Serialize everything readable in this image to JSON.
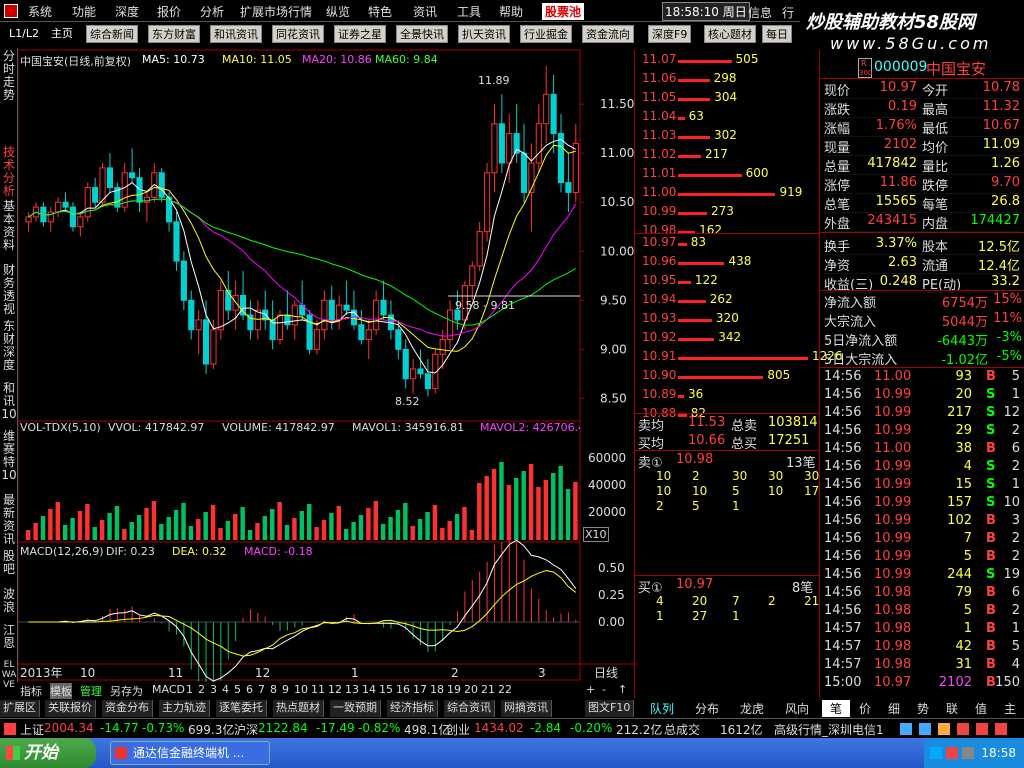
{
  "menu": {
    "items": [
      "系统",
      "功能",
      "深度",
      "报价",
      "分析",
      "扩展市场行情",
      "纵览",
      "特色",
      "资讯",
      "工具",
      "帮助"
    ],
    "hot": "股票池",
    "clock": "18:58:10 周日",
    "info": "信息",
    "trade": "行"
  },
  "watermark": {
    "brand": "炒股辅助教材58股网",
    "url": "www.58Gu.com"
  },
  "tabs": [
    "L1/L2",
    "主页",
    "综合新闻",
    "东方财富",
    "和讯资讯",
    "同花资讯",
    "证券之星",
    "全景快讯",
    "扒天资讯",
    "行业掘金",
    "资金流向",
    "深度F9",
    "核心题材",
    "每日"
  ],
  "sidebar": [
    "分时走势",
    "技术分析",
    "基本资料",
    "财务透视",
    "东财深度",
    "和讯10",
    "维赛特10",
    "最新资讯",
    "股吧",
    "波浪",
    "江恩",
    "EL WA VE"
  ],
  "chart_header": {
    "name": "中国宝安(日线,前复权)",
    "ma5": "MA5: 10.73",
    "ma10": "MA10: 11.05",
    "ma20": "MA20: 10.86",
    "ma60": "MA60: 9.84",
    "high_label": "11.89",
    "low_label": "8.52",
    "range_label": "9.58 - 9.81"
  },
  "vol_header": {
    "name": "VOL-TDX(5,10)",
    "vvol": "VVOL: 417842.97",
    "volume": "VOLUME: 417842.97",
    "mavol1": "MAVOL1: 345916.81",
    "mavol2": "MAVOL2: 426706.4",
    "x10": "X10"
  },
  "macd_header": {
    "name": "MACD(12,26,9)",
    "dif": "DIF: 0.23",
    "dea": "DEA: 0.32",
    "macd": "MACD: -0.18"
  },
  "chart_data": [
    {
      "type": "candlestick",
      "y_ticks": [
        "11.50",
        "11.00",
        "10.50",
        "10.00",
        "9.50",
        "9.00",
        "8.50"
      ],
      "ylim": [
        8.3,
        11.95
      ],
      "x_labels": [
        "2013年",
        "10",
        "11",
        "12",
        "1",
        "2",
        "3"
      ],
      "period_label": "日线",
      "candles": [
        [
          10.3,
          10.4,
          10.2,
          10.35
        ],
        [
          10.35,
          10.5,
          10.3,
          10.45
        ],
        [
          10.45,
          10.5,
          10.25,
          10.3
        ],
        [
          10.3,
          10.45,
          10.2,
          10.4
        ],
        [
          10.4,
          10.55,
          10.35,
          10.5
        ],
        [
          10.5,
          10.6,
          10.4,
          10.45
        ],
        [
          10.45,
          10.5,
          10.2,
          10.25
        ],
        [
          10.25,
          10.4,
          10.15,
          10.35
        ],
        [
          10.35,
          10.7,
          10.3,
          10.65
        ],
        [
          10.65,
          10.75,
          10.45,
          10.5
        ],
        [
          10.5,
          10.9,
          10.45,
          10.85
        ],
        [
          10.85,
          11.0,
          10.6,
          10.65
        ],
        [
          10.65,
          10.7,
          10.4,
          10.45
        ],
        [
          10.45,
          10.9,
          10.4,
          10.8
        ],
        [
          10.8,
          11.05,
          10.7,
          10.75
        ],
        [
          10.75,
          10.85,
          10.4,
          10.5
        ],
        [
          10.5,
          10.6,
          10.3,
          10.55
        ],
        [
          10.55,
          10.9,
          10.5,
          10.8
        ],
        [
          10.8,
          10.85,
          10.5,
          10.55
        ],
        [
          10.55,
          10.6,
          10.2,
          10.3
        ],
        [
          10.3,
          10.4,
          9.8,
          9.9
        ],
        [
          9.9,
          10.0,
          9.4,
          9.5
        ],
        [
          9.5,
          9.6,
          9.1,
          9.2
        ],
        [
          9.2,
          9.4,
          8.95,
          9.3
        ],
        [
          9.3,
          9.5,
          8.75,
          8.85
        ],
        [
          8.85,
          9.3,
          8.8,
          9.2
        ],
        [
          9.2,
          9.7,
          9.1,
          9.6
        ],
        [
          9.6,
          9.8,
          9.3,
          9.4
        ],
        [
          9.4,
          9.7,
          9.2,
          9.55
        ],
        [
          9.55,
          9.8,
          9.3,
          9.35
        ],
        [
          9.35,
          9.5,
          9.1,
          9.2
        ],
        [
          9.2,
          9.5,
          9.1,
          9.4
        ],
        [
          9.4,
          9.6,
          9.2,
          9.3
        ],
        [
          9.3,
          9.5,
          9.0,
          9.1
        ],
        [
          9.1,
          9.4,
          9.05,
          9.35
        ],
        [
          9.35,
          9.6,
          9.2,
          9.25
        ],
        [
          9.25,
          9.5,
          9.1,
          9.45
        ],
        [
          9.45,
          9.7,
          9.3,
          9.35
        ],
        [
          9.35,
          9.4,
          8.95,
          9.0
        ],
        [
          9.0,
          9.3,
          8.95,
          9.2
        ],
        [
          9.2,
          9.6,
          9.1,
          9.5
        ],
        [
          9.5,
          9.65,
          9.2,
          9.3
        ],
        [
          9.3,
          9.55,
          9.2,
          9.45
        ],
        [
          9.45,
          9.7,
          9.35,
          9.4
        ],
        [
          9.4,
          9.6,
          9.2,
          9.25
        ],
        [
          9.25,
          9.4,
          9.05,
          9.1
        ],
        [
          9.1,
          9.3,
          8.9,
          9.2
        ],
        [
          9.2,
          9.6,
          9.15,
          9.5
        ],
        [
          9.5,
          9.7,
          9.3,
          9.35
        ],
        [
          9.35,
          9.5,
          9.1,
          9.2
        ],
        [
          9.2,
          9.3,
          8.9,
          9.0
        ],
        [
          9.0,
          9.1,
          8.6,
          8.7
        ],
        [
          8.7,
          8.9,
          8.55,
          8.8
        ],
        [
          8.8,
          9.0,
          8.7,
          8.75
        ],
        [
          8.75,
          8.9,
          8.52,
          8.6
        ],
        [
          8.6,
          9.0,
          8.55,
          8.95
        ],
        [
          8.95,
          9.2,
          8.8,
          9.1
        ],
        [
          9.1,
          9.5,
          9.0,
          9.4
        ],
        [
          9.4,
          9.6,
          9.2,
          9.3
        ],
        [
          9.3,
          9.7,
          9.2,
          9.65
        ],
        [
          9.65,
          9.9,
          9.5,
          9.85
        ],
        [
          9.85,
          10.3,
          9.8,
          10.2
        ],
        [
          10.2,
          10.9,
          10.1,
          10.8
        ],
        [
          10.8,
          11.5,
          10.6,
          11.3
        ],
        [
          11.3,
          11.6,
          10.8,
          10.9
        ],
        [
          10.9,
          11.4,
          10.7,
          11.2
        ],
        [
          11.2,
          11.5,
          10.9,
          11.0
        ],
        [
          11.0,
          11.3,
          10.5,
          10.6
        ],
        [
          10.6,
          11.1,
          10.2,
          10.9
        ],
        [
          10.9,
          11.5,
          10.8,
          11.3
        ],
        [
          11.3,
          11.89,
          11.1,
          11.6
        ],
        [
          11.6,
          11.8,
          11.0,
          11.2
        ],
        [
          11.2,
          11.4,
          10.6,
          10.7
        ],
        [
          10.7,
          11.0,
          10.4,
          10.6
        ],
        [
          10.6,
          11.3,
          10.5,
          11.1
        ]
      ]
    }
  ],
  "orderbook": {
    "asks": [
      {
        "p": "11.07",
        "v": "505"
      },
      {
        "p": "11.06",
        "v": "298"
      },
      {
        "p": "11.05",
        "v": "304"
      },
      {
        "p": "11.04",
        "v": "63"
      },
      {
        "p": "11.03",
        "v": "302"
      },
      {
        "p": "11.02",
        "v": "217"
      },
      {
        "p": "11.01",
        "v": "600"
      },
      {
        "p": "11.00",
        "v": "919"
      },
      {
        "p": "10.99",
        "v": "273"
      },
      {
        "p": "10.98",
        "v": "162"
      }
    ],
    "bids": [
      {
        "p": "10.97",
        "v": "83"
      },
      {
        "p": "10.96",
        "v": "438"
      },
      {
        "p": "10.95",
        "v": "122"
      },
      {
        "p": "10.94",
        "v": "262"
      },
      {
        "p": "10.93",
        "v": "320"
      },
      {
        "p": "10.92",
        "v": "342"
      },
      {
        "p": "10.91",
        "v": "1226"
      },
      {
        "p": "10.90",
        "v": "805"
      },
      {
        "p": "10.89",
        "v": "36"
      },
      {
        "p": "10.88",
        "v": "82"
      }
    ],
    "sell_avg_label": "卖均",
    "sell_avg": "11.53",
    "total_sell_label": "总卖",
    "total_sell": "103814",
    "buy_avg_label": "买均",
    "buy_avg": "10.66",
    "total_buy_label": "总买",
    "total_buy": "17251",
    "sell1_label": "卖①",
    "sell1_price": "10.98",
    "sell1_count": "13笔",
    "sell1_queue": [
      [
        "10",
        "2",
        "30",
        "30",
        "30"
      ],
      [
        "10",
        "10",
        "5",
        "10",
        "17"
      ],
      [
        "2",
        "5",
        "1"
      ]
    ],
    "buy1_label": "买①",
    "buy1_price": "10.97",
    "buy1_count": "8笔",
    "buy1_queue": [
      [
        "4",
        "20",
        "7",
        "2",
        "21"
      ],
      [
        "1",
        "27",
        "1"
      ]
    ]
  },
  "stock": {
    "code": "000009",
    "name": "中国宝安",
    "badge_top": "R",
    "badge_bottom": "300"
  },
  "quote": [
    [
      "现价",
      "10.97",
      "今开",
      "10.78"
    ],
    [
      "涨跌",
      "0.19",
      "最高",
      "11.32"
    ],
    [
      "涨幅",
      "1.76%",
      "最低",
      "10.67"
    ],
    [
      "现量",
      "2102",
      "均价",
      "11.09"
    ],
    [
      "总量",
      "417842",
      "量比",
      "1.26"
    ],
    [
      "涨停",
      "11.86",
      "跌停",
      "9.70"
    ],
    [
      "总笔",
      "15565",
      "每笔",
      "26.8"
    ],
    [
      "外盘",
      "243415",
      "内盘",
      "174427"
    ],
    [
      "换手",
      "3.37%",
      "股本",
      "12.5亿"
    ],
    [
      "净资",
      "2.63",
      "流通",
      "12.4亿"
    ],
    [
      "收益(三)",
      "0.248",
      "PE(动)",
      "33.2"
    ]
  ],
  "flow": [
    [
      "净流入额",
      "6754万",
      "15%"
    ],
    [
      "大宗流入",
      "5044万",
      "11%"
    ],
    [
      "5日净流入额",
      "-6443万",
      "-3%"
    ],
    [
      "5日大宗流入",
      "-1.02亿",
      "-5%"
    ]
  ],
  "ticks": [
    [
      "14:56",
      "11.00",
      "93",
      "B",
      "5"
    ],
    [
      "14:56",
      "10.99",
      "20",
      "S",
      "1"
    ],
    [
      "14:56",
      "10.99",
      "217",
      "S",
      "12"
    ],
    [
      "14:56",
      "10.99",
      "29",
      "S",
      "2"
    ],
    [
      "14:56",
      "11.00",
      "38",
      "B",
      "6"
    ],
    [
      "14:56",
      "10.99",
      "4",
      "S",
      "2"
    ],
    [
      "14:56",
      "10.99",
      "15",
      "S",
      "1"
    ],
    [
      "14:56",
      "10.99",
      "157",
      "S",
      "10"
    ],
    [
      "14:56",
      "10.99",
      "102",
      "B",
      "3"
    ],
    [
      "14:56",
      "10.99",
      "7",
      "B",
      "2"
    ],
    [
      "14:56",
      "10.99",
      "5",
      "B",
      "2"
    ],
    [
      "14:56",
      "10.99",
      "244",
      "S",
      "19"
    ],
    [
      "14:56",
      "10.98",
      "79",
      "B",
      "6"
    ],
    [
      "14:56",
      "10.98",
      "5",
      "B",
      "2"
    ],
    [
      "14:57",
      "10.98",
      "1",
      "B",
      "1"
    ],
    [
      "14:57",
      "10.98",
      "42",
      "B",
      "5"
    ],
    [
      "14:57",
      "10.98",
      "31",
      "B",
      "4"
    ],
    [
      "15:00",
      "10.97",
      "2102",
      "B",
      "150"
    ]
  ],
  "bottom_tabs": [
    "指标",
    "模板",
    "管理",
    "另存为",
    "MACD",
    "1",
    "2",
    "3",
    "4",
    "5",
    "6",
    "7",
    "8",
    "9",
    "10",
    "11",
    "12",
    "13",
    "14",
    "15",
    "16",
    "17",
    "18",
    "19",
    "20",
    "21",
    "22"
  ],
  "bottom_tabs2": [
    "扩展区",
    "关联报价",
    "资金分布",
    "主力轨迹",
    "逐笔委托",
    "热点题材",
    "一致预期",
    "经济指标",
    "综合资讯",
    "网摘资讯"
  ],
  "bottom_tabs2_right": "图文F10",
  "ob_tabs": [
    "队列",
    "分布",
    "龙虎",
    "风向"
  ],
  "right_tabs": [
    "笔",
    "价",
    "细",
    "势",
    "联",
    "值",
    "主"
  ],
  "status": {
    "sh_label": "上证",
    "sh_val": "2004.34",
    "sh_chg": "-14.77",
    "sh_pct": "-0.73%",
    "sh_amt": "699.3亿",
    "sz_label": "沪深",
    "sz_val": "2122.84",
    "sz_chg": "-17.49",
    "sz_pct": "-0.82%",
    "sz_amt": "498.1亿",
    "cy_label": "创业",
    "cy_val": "1434.02",
    "cy_chg": "-2.84",
    "cy_pct": "-0.20%",
    "cy_amt": "212.2亿",
    "total_label": "总成交",
    "total_val": "1612亿",
    "line": "高级行情_深圳电信1"
  },
  "taskbar": {
    "start": "开始",
    "window": "通达信金融终端机 ...",
    "time": "18:58"
  },
  "colors": {
    "up": "#ff3030",
    "down": "#00d0d0",
    "ma5": "#ffffff",
    "ma10": "#ffff00",
    "ma20": "#ff00ff",
    "ma60": "#00ff00"
  }
}
